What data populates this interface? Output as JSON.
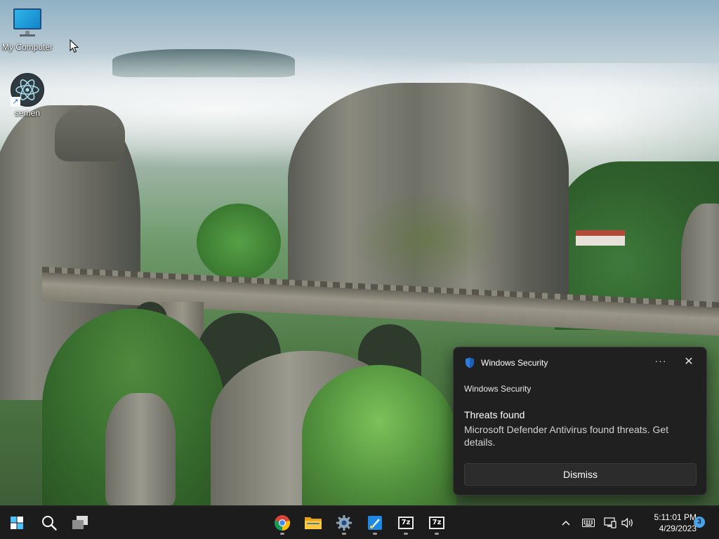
{
  "desktop": {
    "icons": [
      {
        "label": "My Computer",
        "icon": "monitor-icon"
      },
      {
        "label": "semen",
        "icon": "electron-app-icon"
      }
    ]
  },
  "notification": {
    "app_name": "Windows Security",
    "attribution": "Windows Security",
    "more_label": "···",
    "close_label": "✕",
    "title": "Threats found",
    "body": "Microsoft Defender Antivirus found threats. Get details.",
    "dismiss_label": "Dismiss",
    "accent": "#2f7de1"
  },
  "taskbar": {
    "start_icon": "windows-start-icon",
    "search_icon": "search-icon",
    "task_view_icon": "task-view-icon",
    "apps": [
      {
        "name": "chrome",
        "icon": "chrome-icon",
        "running": true
      },
      {
        "name": "file-explorer",
        "icon": "folder-icon",
        "running": false
      },
      {
        "name": "settings",
        "icon": "gear-icon",
        "running": true
      },
      {
        "name": "paint",
        "icon": "paint-icon",
        "running": true
      },
      {
        "name": "7-zip",
        "icon": "7z-icon",
        "label": "7z",
        "running": true
      },
      {
        "name": "7-zip",
        "icon": "7z-icon",
        "label": "7z",
        "running": true
      }
    ],
    "tray": {
      "chevron": "⌃",
      "keyboard_icon": "keyboard-icon",
      "network_icon": "network-icon",
      "volume_icon": "volume-icon"
    },
    "clock": {
      "time": "5:11:01 PM",
      "date": "4/29/2023"
    },
    "notification_count": "3"
  }
}
